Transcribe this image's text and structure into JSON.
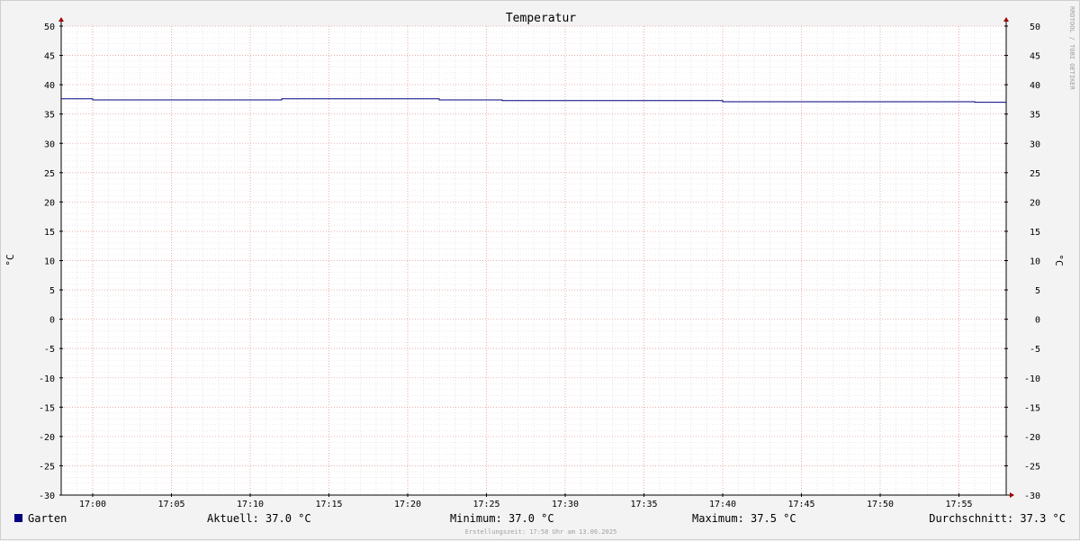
{
  "chart_data": {
    "type": "line",
    "title": "Temperatur",
    "ylabel_left": "°C",
    "ylabel_right": "°C",
    "y_range": [
      -30,
      50
    ],
    "y_ticks": [
      50,
      45,
      40,
      35,
      30,
      25,
      20,
      15,
      10,
      5,
      0,
      -5,
      -10,
      -15,
      -20,
      -25,
      -30
    ],
    "x_tick_labels": [
      "17:00",
      "17:05",
      "17:10",
      "17:15",
      "17:20",
      "17:25",
      "17:30",
      "17:35",
      "17:40",
      "17:45",
      "17:50",
      "17:55"
    ],
    "x_range": [
      "16:58",
      "17:58"
    ],
    "grid": true,
    "series": [
      {
        "name": "Garten",
        "color": "#000080",
        "points": [
          [
            "16:58",
            37.6
          ],
          [
            "17:00",
            37.4
          ],
          [
            "17:12",
            37.6
          ],
          [
            "17:22",
            37.4
          ],
          [
            "17:26",
            37.3
          ],
          [
            "17:40",
            37.1
          ],
          [
            "17:56",
            37.0
          ],
          [
            "17:58",
            37.0
          ]
        ]
      }
    ]
  },
  "legend": {
    "series_label": "Garten",
    "series_color": "#000080",
    "current": "Aktuell: 37.0 °C",
    "minimum": "Minimum: 37.0 °C",
    "maximum": "Maximum: 37.5 °C",
    "average": "Durchschnitt: 37.3 °C"
  },
  "footer": {
    "created": "Erstellungszeit: 17:58 Uhr am 13.06.2025"
  },
  "watermark": "RRDTOOL / TOBI OETIKER"
}
